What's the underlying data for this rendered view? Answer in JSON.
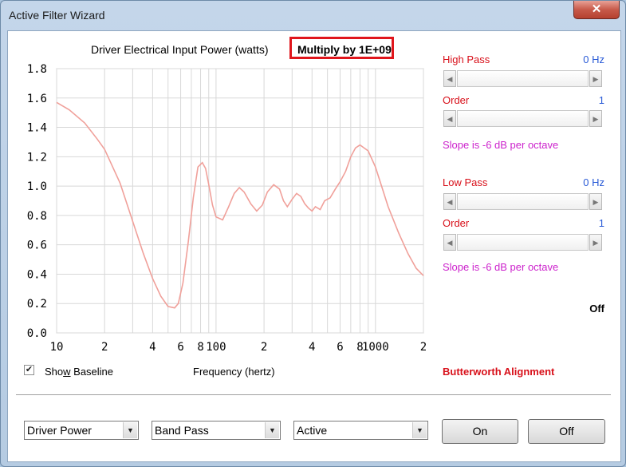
{
  "window": {
    "title": "Active Filter Wizard",
    "close_glyph": "✕"
  },
  "plot_header": {
    "title": "Driver Electrical Input Power (watts)",
    "multiply": "Multiply by 1E+09"
  },
  "chart_data": {
    "type": "line",
    "title": "Driver Electrical Input Power (watts)",
    "xlabel": "Frequency (hertz)",
    "ylabel": "",
    "x_scale": "log",
    "xlim": [
      10,
      2000
    ],
    "ylim": [
      0,
      1.8
    ],
    "y_ticks": [
      "1.8",
      "1.6",
      "1.4",
      "1.2",
      "1.0",
      "0.8",
      "0.6",
      "0.4",
      "0.2",
      "0.0"
    ],
    "x_tick_labels": [
      "10",
      "2",
      "4",
      "6",
      "8",
      "100",
      "2",
      "4",
      "6",
      "8",
      "1000",
      "2"
    ],
    "grid": true,
    "series": [
      {
        "color": "#f0a09a",
        "x": [
          10,
          12,
          15,
          18,
          20,
          25,
          30,
          35,
          40,
          45,
          50,
          55,
          58,
          62,
          67,
          72,
          77,
          82,
          86,
          90,
          95,
          100,
          110,
          120,
          130,
          140,
          150,
          165,
          180,
          195,
          210,
          230,
          250,
          265,
          280,
          300,
          320,
          340,
          360,
          380,
          400,
          420,
          450,
          480,
          520,
          560,
          600,
          650,
          700,
          750,
          800,
          900,
          1000,
          1100,
          1200,
          1400,
          1600,
          1800,
          2000
        ],
        "y": [
          1.57,
          1.52,
          1.43,
          1.32,
          1.25,
          1.02,
          0.76,
          0.54,
          0.37,
          0.25,
          0.18,
          0.17,
          0.2,
          0.34,
          0.62,
          0.92,
          1.13,
          1.16,
          1.12,
          1.01,
          0.87,
          0.79,
          0.77,
          0.86,
          0.95,
          0.99,
          0.96,
          0.88,
          0.83,
          0.87,
          0.96,
          1.01,
          0.98,
          0.9,
          0.86,
          0.91,
          0.95,
          0.93,
          0.88,
          0.85,
          0.83,
          0.86,
          0.84,
          0.9,
          0.92,
          0.98,
          1.03,
          1.1,
          1.2,
          1.26,
          1.28,
          1.24,
          1.13,
          0.99,
          0.86,
          0.68,
          0.54,
          0.44,
          0.39
        ]
      }
    ]
  },
  "filter": {
    "high_pass": {
      "label": "High Pass",
      "value": "0 Hz"
    },
    "high_order": {
      "label": "Order",
      "value": "1"
    },
    "high_slope": "Slope is -6 dB per octave",
    "low_pass": {
      "label": "Low Pass",
      "value": "0 Hz"
    },
    "low_order": {
      "label": "Order",
      "value": "1"
    },
    "low_slope": "Slope is -6 dB per octave",
    "state": "Off",
    "alignment": "Butterworth Alignment"
  },
  "baseline": {
    "label_pre": "Sho",
    "label_ul": "w",
    "label_post": " Baseline",
    "checked": true,
    "check_glyph": "✔"
  },
  "x_axis_title": "Frequency (hertz)",
  "controls": {
    "display_select": "Driver Power",
    "type_select": "Band Pass",
    "mode_select": "Active",
    "on_label": "On",
    "off_label": "Off",
    "dropdown_glyph": "▼"
  },
  "colors": {
    "red_label": "#d8101a",
    "blue_value": "#2a5bd7",
    "magenta": "#cc22cc",
    "curve": "#f0a09a"
  }
}
